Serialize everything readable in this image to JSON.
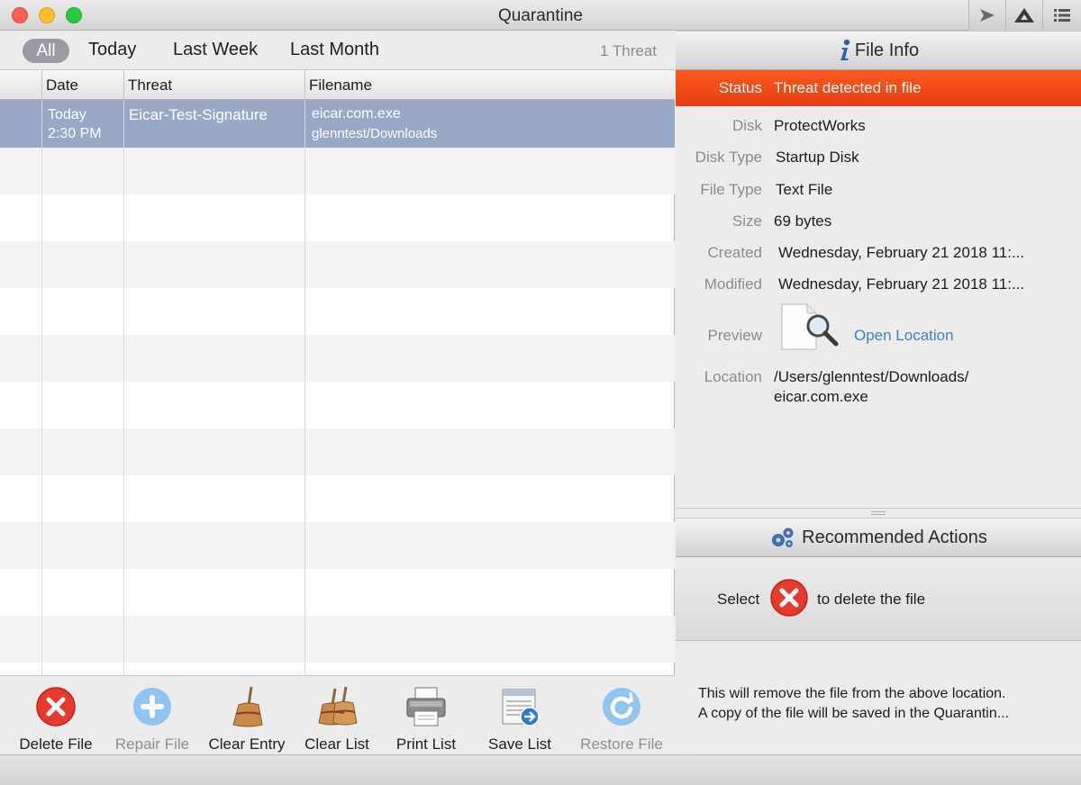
{
  "window": {
    "title": "Quarantine"
  },
  "filters": {
    "all": "All",
    "today": "Today",
    "last_week": "Last Week",
    "last_month": "Last Month",
    "count": "1 Threat"
  },
  "table": {
    "headers": {
      "date": "Date",
      "threat": "Threat",
      "filename": "Filename"
    },
    "rows": [
      {
        "date": "Today",
        "time": "2:30 PM",
        "threat": "Eicar-Test-Signature",
        "filename": "eicar.com.exe",
        "path": "glenntest/Downloads"
      }
    ]
  },
  "toolbar": {
    "delete_file": "Delete File",
    "repair_file": "Repair File",
    "clear_entry": "Clear Entry",
    "clear_list": "Clear List",
    "print_list": "Print List",
    "save_list": "Save List",
    "restore_file": "Restore File"
  },
  "file_info": {
    "heading": "File Info",
    "status_label": "Status",
    "status_value": "Threat detected in file",
    "disk_label": "Disk",
    "disk_value": "ProtectWorks",
    "disk_type_label": "Disk Type",
    "disk_type_value": "Startup Disk",
    "file_type_label": "File Type",
    "file_type_value": "Text File",
    "size_label": "Size",
    "size_value": "69 bytes",
    "created_label": "Created",
    "created_value": "Wednesday, February 21 2018 11:...",
    "modified_label": "Modified",
    "modified_value": "Wednesday, February 21 2018 11:...",
    "preview_label": "Preview",
    "open_location": "Open Location",
    "location_label": "Location",
    "location_line1": "/Users/glenntest/Downloads/",
    "location_line2": "eicar.com.exe"
  },
  "recommended": {
    "heading": "Recommended Actions",
    "select_text": "Select",
    "action_text": "to delete the file",
    "desc_line1": "This will remove the file from the above location.",
    "desc_line2": "A copy of the file will be saved in the Quarantin..."
  },
  "colors": {
    "selection": "#98a8c6",
    "status_red": "#f24b1a",
    "link": "#3f82c4",
    "delete_red": "#e8392e"
  }
}
